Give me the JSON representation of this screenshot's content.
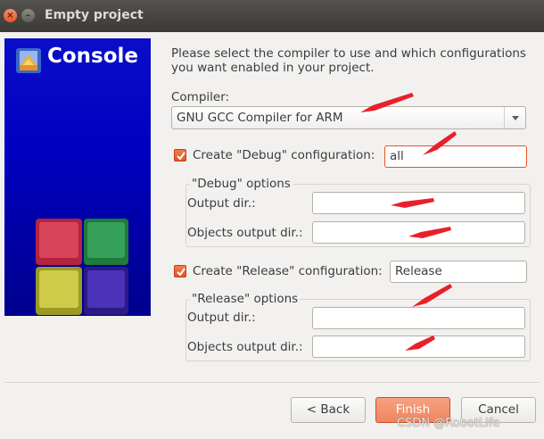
{
  "window": {
    "title": "Empty project",
    "close_glyph": "×",
    "minimize_glyph": "–"
  },
  "banner": {
    "heading": "Console",
    "logo_icon": "codeblocks-icon",
    "art": "rubiks-cube-art",
    "background_color": "#0000c0"
  },
  "intro": "Please select the compiler to use and which configurations you want enabled in your project.",
  "compiler": {
    "label": "Compiler:",
    "selected": "GNU GCC Compiler for ARM"
  },
  "debug": {
    "checkbox_label": "Create \"Debug\" configuration:",
    "checked": true,
    "name_value": "all",
    "group_title": "\"Debug\" options",
    "output_dir_label": "Output dir.:",
    "output_dir_value": "",
    "objects_dir_label": "Objects output dir.:",
    "objects_dir_value": ""
  },
  "release": {
    "checkbox_label": "Create \"Release\" configuration:",
    "checked": true,
    "name_value": "Release",
    "group_title": "\"Release\" options",
    "output_dir_label": "Output dir.:",
    "output_dir_value": "",
    "objects_dir_label": "Objects output dir.:",
    "objects_dir_value": ""
  },
  "buttons": {
    "back": "< Back",
    "finish": "Finish",
    "cancel": "Cancel"
  },
  "watermark": "CSDN @RobotLife",
  "colors": {
    "accent": "#e95420",
    "annotation_arrow": "#e8202a"
  }
}
